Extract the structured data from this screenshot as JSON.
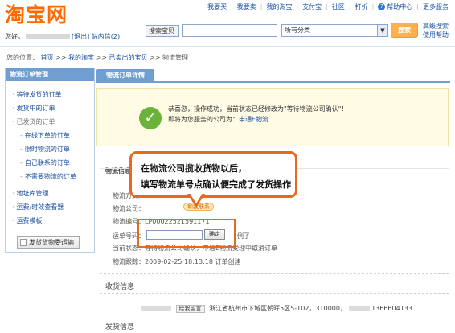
{
  "header": {
    "logo": "淘宝网",
    "nav": [
      "我要买",
      "我要卖",
      "我的淘宝",
      "支付宝",
      "社区",
      "打折",
      "帮助中心",
      "更多服务"
    ],
    "greeting_prefix": "您好，",
    "logout": "[退出]",
    "messages": "站内信(2)",
    "search_category": "搜索宝贝",
    "search_value": "",
    "category_select": "所有分类",
    "search_button": "搜索",
    "adv_search_1": "高级搜索",
    "adv_search_2": "使用帮助"
  },
  "breadcrumb": {
    "prefix": "您的位置：",
    "items": [
      "首页",
      "我的淘宝",
      "已卖出的宝贝",
      "物流管理"
    ],
    "separator": ">>"
  },
  "sidebar": {
    "title": "物流订单管理",
    "items": [
      "等待发货的订单",
      "发货中的订单",
      "已发货的订单",
      "在线下单的订单",
      "限时物流的订单",
      "自己联系的订单",
      "不需要物流的订单",
      "地址库管理",
      "运费/时效查看器",
      "运费模板"
    ],
    "button": "发货货物委运输"
  },
  "tab": {
    "label": "物流订单详情"
  },
  "success": {
    "line1": "恭喜您，操作成功，当前状态已经修改为\"等待物流公司确认\"！",
    "line2_prefix": "即将为您服务的公司为：",
    "company": "申通E物流"
  },
  "logistics": {
    "title": "物流信息",
    "rows": {
      "method": "物流方式：",
      "company": "物流公司：",
      "order_no_label": "物流编号：",
      "order_no": "LP00022521591171",
      "tracking_label": "运单号码：",
      "status_label": "当前状态：",
      "status_value": "等待物流公司确认，申通E物流受理中...",
      "cancel": "取消订单",
      "track_label": "物流跟踪：",
      "track_value": "2009-02-25 18:13:18 订单创建",
      "example": "例子"
    },
    "wangwang": "和我联系",
    "confirm_button": "确定"
  },
  "callout": {
    "line1": "在物流公司揽收货物以后，",
    "line2": "填写物流单号点确认便完成了发货操作"
  },
  "receiver": {
    "title": "收货信息",
    "message_button": "给我留言",
    "address": "浙江省杭州市下城区朝晖5区5-102，310000，",
    "phone": "1366604133"
  },
  "shipping": {
    "title": "发货信息"
  },
  "colors": {
    "accent": "#ff6a00",
    "sidebar_blue": "#6f9fd1",
    "callout_border": "#e56a1f",
    "success_green": "#6ab23a"
  }
}
